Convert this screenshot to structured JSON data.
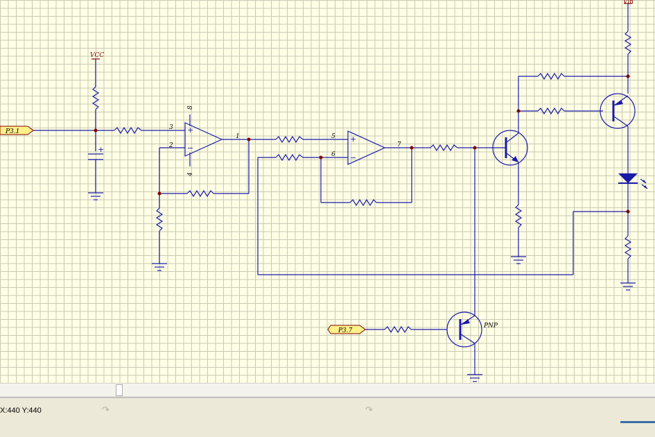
{
  "labels": {
    "vcc": "VCC",
    "vin": "Vin",
    "pnp": "PNP",
    "port_p31": "P3.1",
    "port_p37": "P3.7",
    "pin3": "3",
    "pin2": "2",
    "pin8": "8",
    "pin4": "4",
    "pin1": "1",
    "pin5": "5",
    "pin6": "6",
    "pin7": "7",
    "plus1": "+",
    "minus1": "−",
    "plus2": "+",
    "minus2": "−",
    "capplus": "+"
  },
  "status": {
    "coords": "X:440 Y:440"
  },
  "icons": {
    "status_left": "redo-arrow-icon",
    "status_mid": "redo-arrow-icon"
  },
  "colors": {
    "wire": "#1a1aa8",
    "junction": "#800000",
    "power": "#800000",
    "port_fill": "#fff08a"
  }
}
